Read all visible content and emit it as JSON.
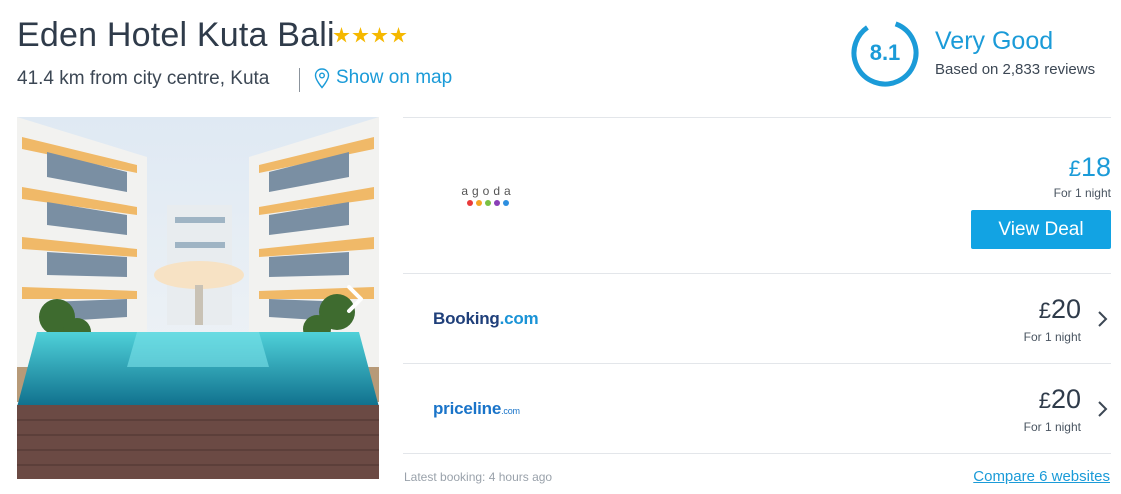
{
  "hotel": {
    "name": "Eden Hotel Kuta Bali",
    "star_count": 4,
    "distance": "41.4 km from city centre, Kuta",
    "map_link": "Show on map"
  },
  "rating": {
    "score": "8.1",
    "label": "Very Good",
    "reviews": "Based on 2,833 reviews",
    "accent_color": "#1b9bd8"
  },
  "photo": {
    "next_icon": "chevron-right-icon"
  },
  "deals": [
    {
      "provider": "agoda",
      "currency": "£",
      "price": "18",
      "per": "For 1 night",
      "button": "View Deal"
    },
    {
      "provider_a": "Booking",
      "provider_b": ".com",
      "currency": "£",
      "price": "20",
      "per": "For 1 night"
    },
    {
      "provider": "priceline",
      "provider_tld": ".com",
      "currency": "£",
      "price": "20",
      "per": "For 1 night"
    }
  ],
  "footer": {
    "latest_booking": "Latest booking: 4 hours ago",
    "compare": "Compare 6 websites"
  },
  "colors": {
    "primary_button": "#12a3e3",
    "star": "#f5b800"
  }
}
